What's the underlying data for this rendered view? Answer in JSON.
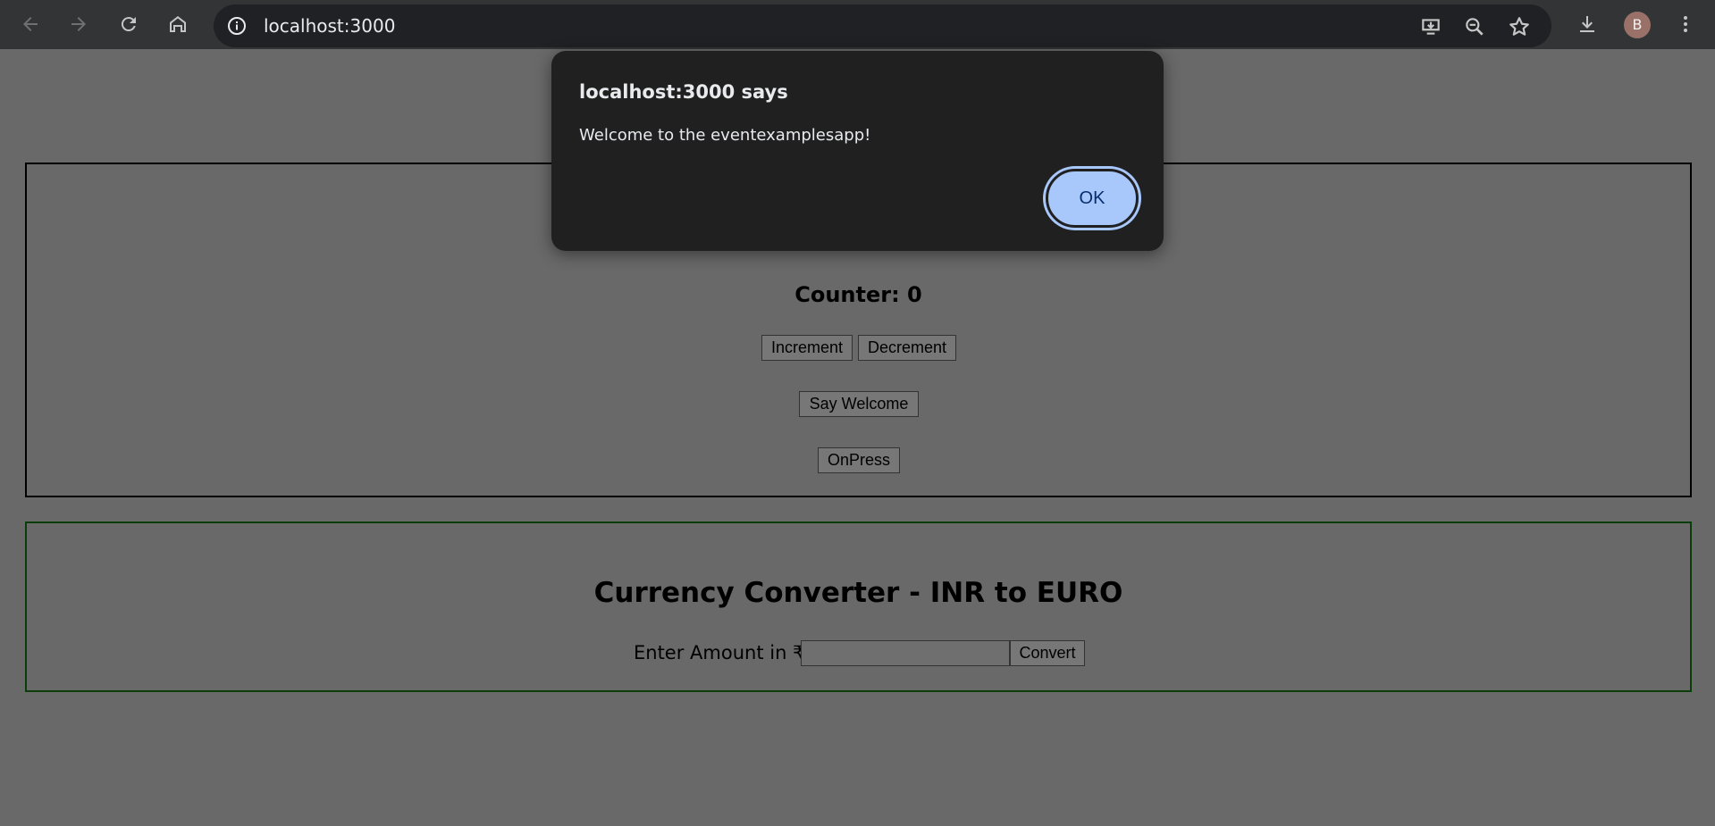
{
  "browser": {
    "url": "localhost:3000",
    "avatar_initial": "B",
    "icons": [
      "back-icon",
      "forward-icon",
      "reload-icon",
      "home-icon",
      "site-info-icon",
      "install-app-icon",
      "zoom-icon",
      "bookmark-star-icon",
      "download-icon",
      "menu-dots-icon"
    ]
  },
  "page": {
    "counter_text": "Counter: 0",
    "increment_label": "Increment",
    "decrement_label": "Decrement",
    "say_welcome_label": "Say Welcome",
    "onpress_label": "OnPress"
  },
  "converter": {
    "title": "Currency Converter - INR to EURO",
    "amount_label": "Enter Amount in ₹:",
    "amount_value": "",
    "convert_label": "Convert"
  },
  "alert": {
    "title": "localhost:3000 says",
    "message": "Welcome to the eventexamplesapp!",
    "ok_label": "OK"
  },
  "colors": {
    "page_overlay": "#696969",
    "dialog_bg": "#202021",
    "ok_button": "#a8c7fa",
    "panel2_border": "#0b3d0b"
  }
}
